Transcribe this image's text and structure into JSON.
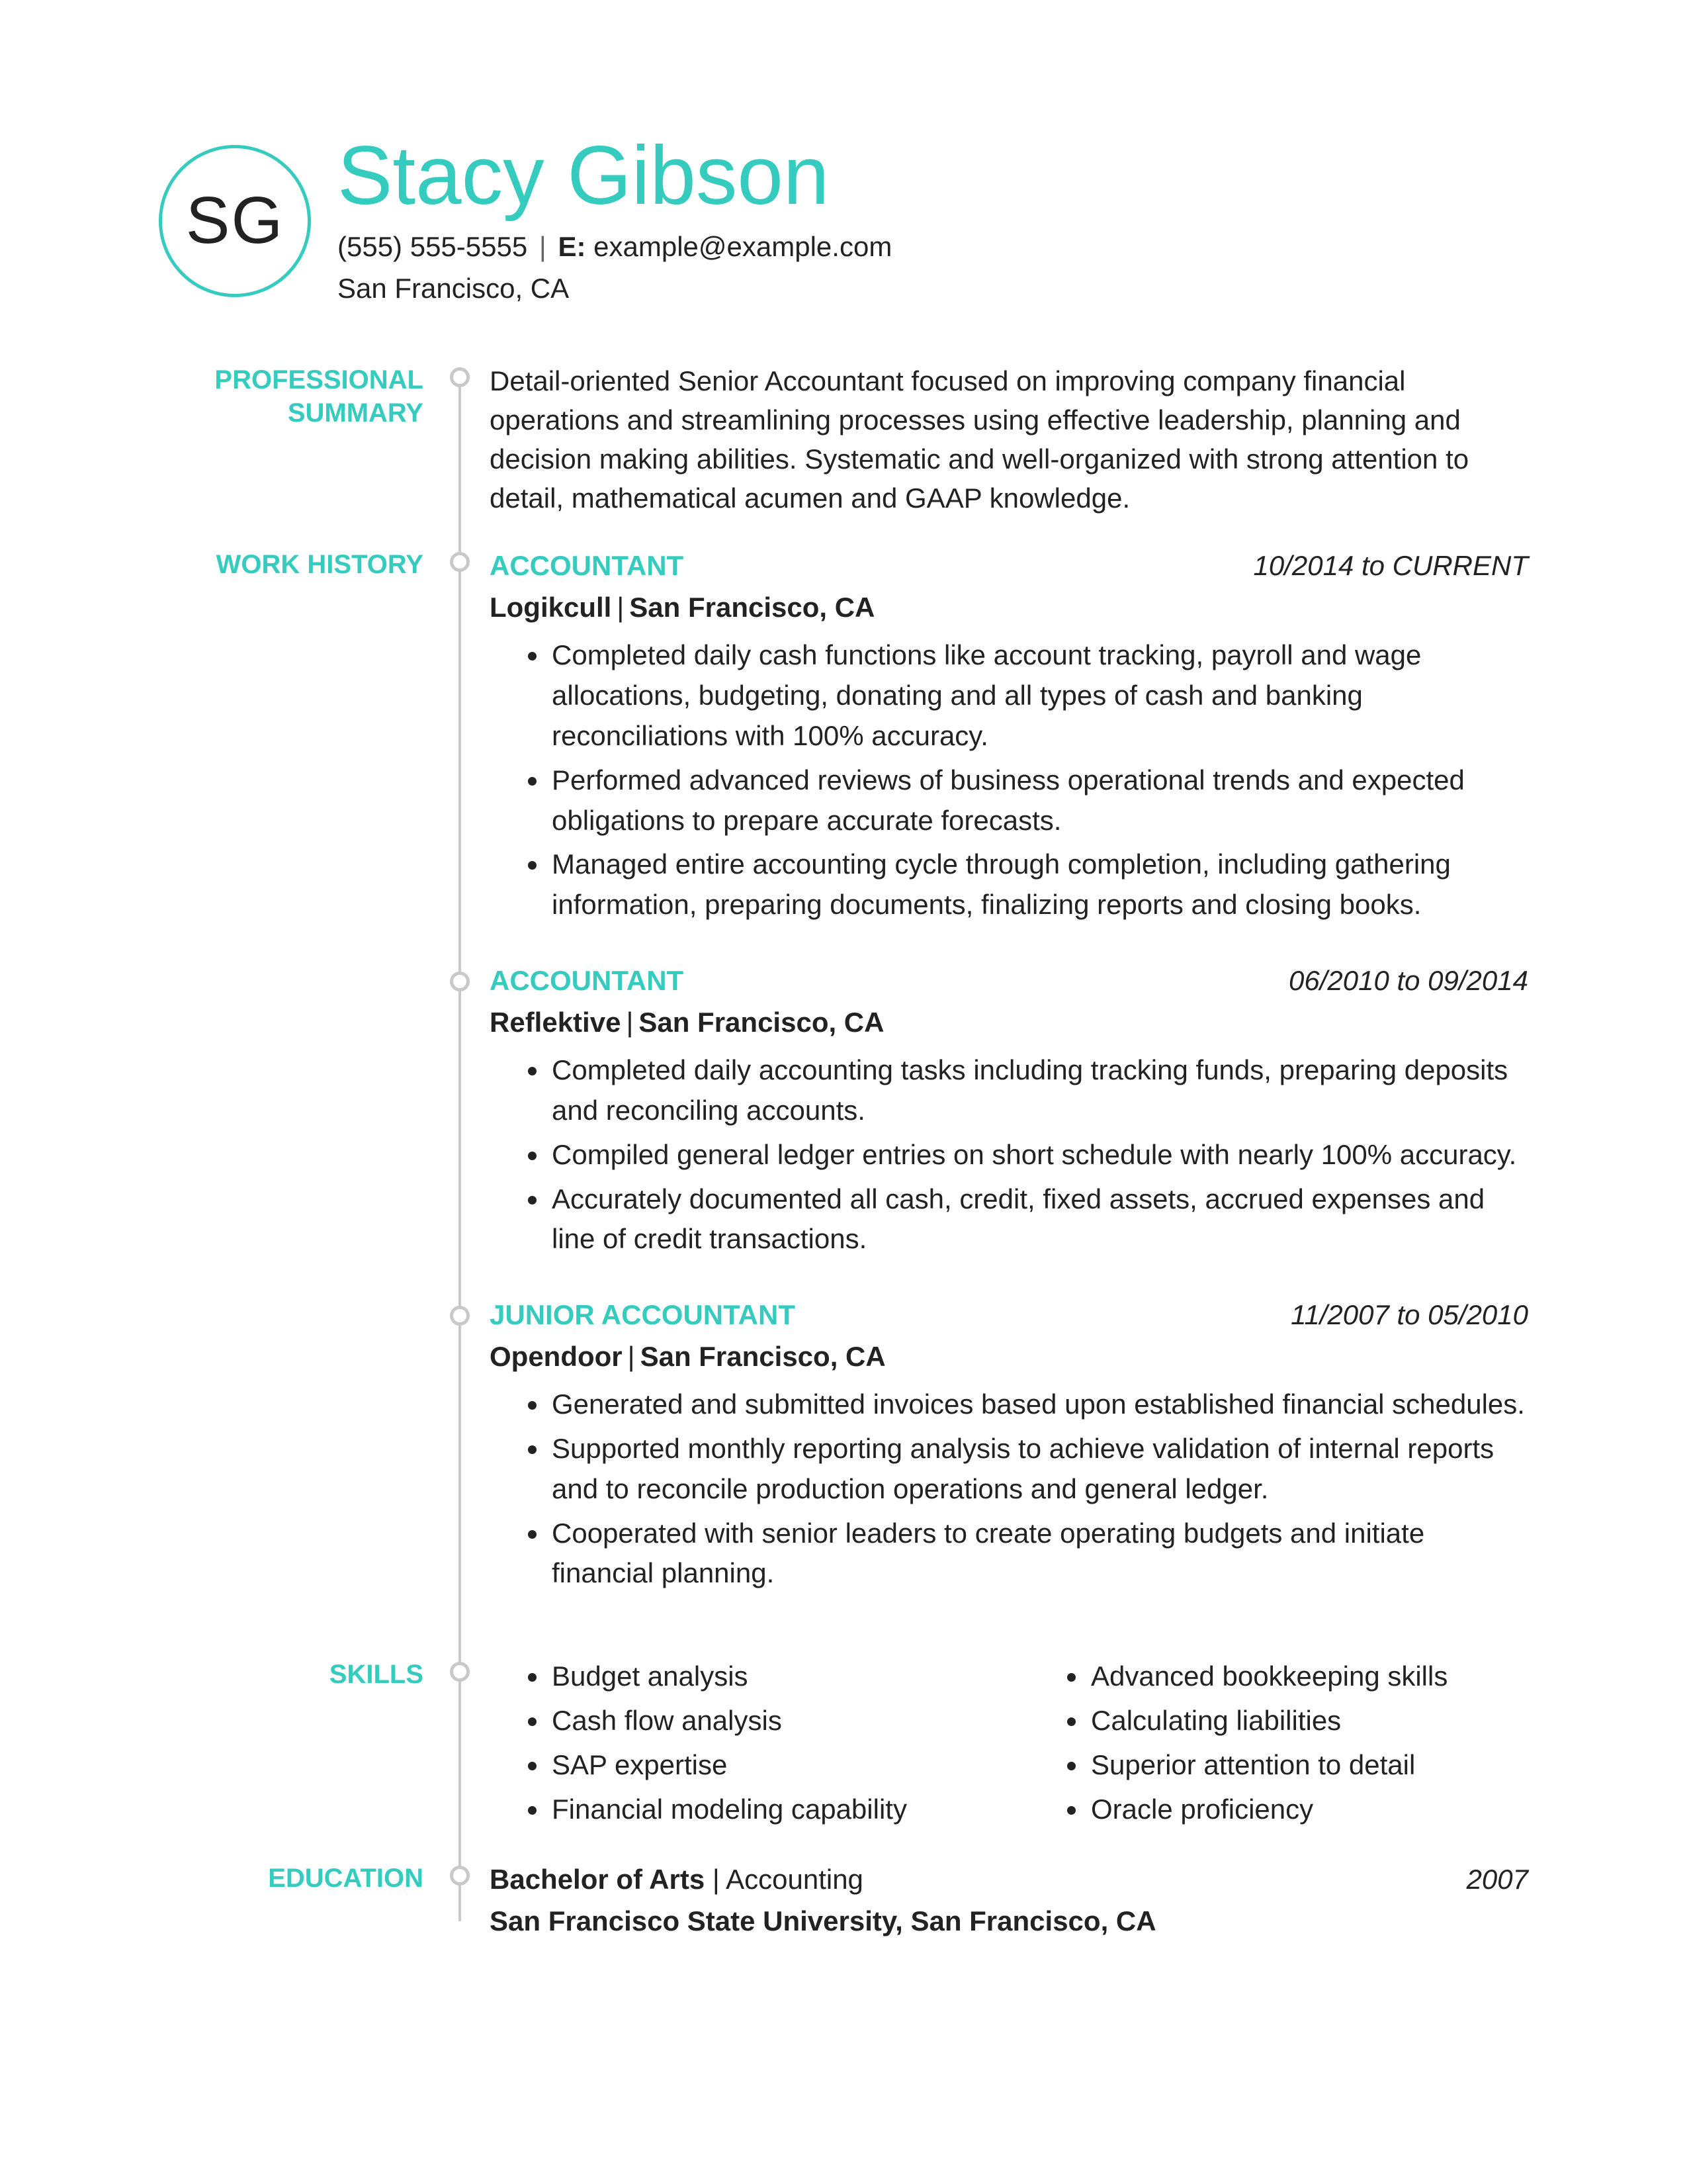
{
  "accent": "#35cbbf",
  "initials": "SG",
  "name": "Stacy Gibson",
  "contact": {
    "phone": "(555) 555-5555",
    "email_label": "E:",
    "email": "example@example.com",
    "location": "San Francisco, CA",
    "sep": "|"
  },
  "sections": {
    "summary": {
      "label": "PROFESSIONAL SUMMARY",
      "text": "Detail-oriented Senior Accountant focused on improving company financial operations and streamlining processes using effective leadership, planning and decision making abilities. Systematic and well-organized with strong attention to detail, mathematical acumen and GAAP knowledge."
    },
    "work": {
      "label": "WORK HISTORY",
      "jobs": [
        {
          "title": "ACCOUNTANT",
          "dates": "10/2014 to CURRENT",
          "company": "Logikcull",
          "location": "San Francisco, CA",
          "bullets": [
            "Completed daily cash functions like account tracking, payroll and wage allocations, budgeting, donating and all types of cash and banking reconciliations with 100% accuracy.",
            "Performed advanced reviews of business operational trends and expected obligations to prepare accurate forecasts.",
            "Managed entire accounting cycle through completion, including gathering information, preparing documents, finalizing reports and closing books."
          ]
        },
        {
          "title": "ACCOUNTANT",
          "dates": "06/2010 to 09/2014",
          "company": "Reflektive",
          "location": "San Francisco, CA",
          "bullets": [
            "Completed daily accounting tasks including tracking funds, preparing deposits and reconciling accounts.",
            "Compiled general ledger entries on short schedule with nearly 100% accuracy.",
            "Accurately documented all cash, credit, fixed assets, accrued expenses and line of credit transactions."
          ]
        },
        {
          "title": "JUNIOR ACCOUNTANT",
          "dates": "11/2007 to 05/2010",
          "company": "Opendoor",
          "location": "San Francisco, CA",
          "bullets": [
            "Generated and submitted invoices based upon established financial schedules.",
            "Supported monthly reporting analysis to achieve validation of internal reports and to reconcile production operations and general ledger.",
            "Cooperated with senior leaders to create operating budgets and initiate financial planning."
          ]
        }
      ]
    },
    "skills": {
      "label": "SKILLS",
      "col1": [
        "Budget analysis",
        "Cash flow analysis",
        "SAP expertise",
        "Financial modeling capability"
      ],
      "col2": [
        "Advanced bookkeeping skills",
        "Calculating liabilities",
        "Superior attention to detail",
        "Oracle proficiency"
      ]
    },
    "education": {
      "label": "EDUCATION",
      "degree": "Bachelor of Arts",
      "field": "Accounting",
      "year": "2007",
      "school": "San Francisco State University, San Francisco, CA",
      "sep": "|"
    }
  }
}
